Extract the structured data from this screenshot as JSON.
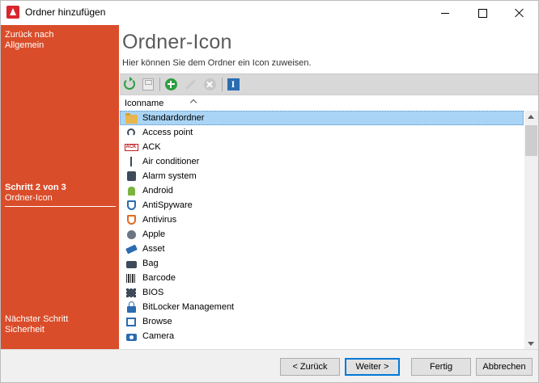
{
  "window": {
    "title": "Ordner hinzufügen"
  },
  "sidebar": {
    "back_line1": "Zurück nach",
    "back_line2": "Allgemein",
    "step_line1": "Schritt 2 von 3",
    "step_line2": "Ordner-Icon",
    "next_line1": "Nächster Schritt",
    "next_line2": "Sicherheit"
  },
  "header": {
    "title": "Ordner-Icon",
    "description": "Hier können Sie dem Ordner ein Icon zuweisen."
  },
  "list": {
    "column": "Iconname",
    "items": [
      {
        "label": "Standardordner",
        "icon": "folder-icon",
        "selected": true
      },
      {
        "label": "Access point",
        "icon": "access-point-icon"
      },
      {
        "label": "ACK",
        "icon": "ack-icon"
      },
      {
        "label": "Air conditioner",
        "icon": "air-conditioner-icon"
      },
      {
        "label": "Alarm system",
        "icon": "alarm-system-icon"
      },
      {
        "label": "Android",
        "icon": "android-icon"
      },
      {
        "label": "AntiSpyware",
        "icon": "antispyware-icon"
      },
      {
        "label": "Antivirus",
        "icon": "antivirus-icon"
      },
      {
        "label": "Apple",
        "icon": "apple-icon"
      },
      {
        "label": "Asset",
        "icon": "asset-icon"
      },
      {
        "label": "Bag",
        "icon": "bag-icon"
      },
      {
        "label": "Barcode",
        "icon": "barcode-icon"
      },
      {
        "label": "BIOS",
        "icon": "bios-icon"
      },
      {
        "label": "BitLocker Management",
        "icon": "bitlocker-icon"
      },
      {
        "label": "Browse",
        "icon": "browse-icon"
      },
      {
        "label": "Camera",
        "icon": "camera-icon"
      }
    ]
  },
  "footer": {
    "back": "< Zurück",
    "next": "Weiter >",
    "finish": "Fertig",
    "cancel": "Abbrechen"
  },
  "colors": {
    "sidebar": "#da4d2a",
    "selection": "#a9d4f5",
    "accent": "#0078d7"
  }
}
